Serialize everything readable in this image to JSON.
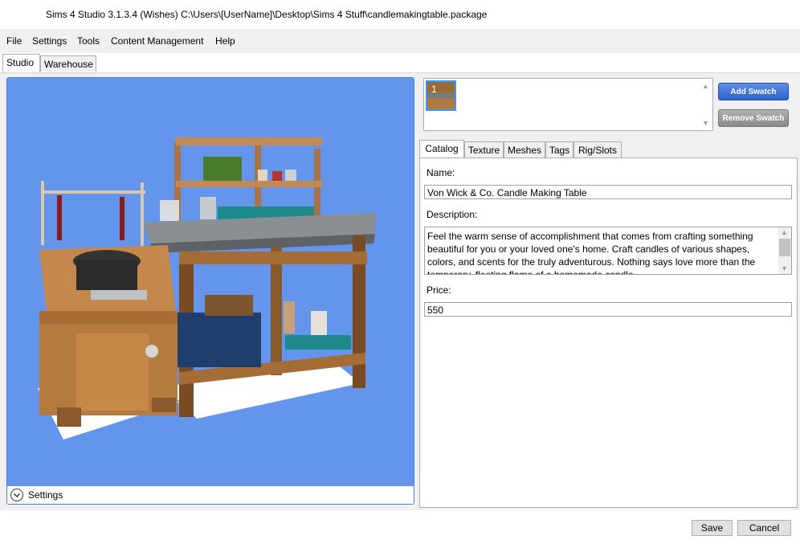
{
  "window": {
    "title": "Sims 4 Studio 3.1.3.4 (Wishes)  C:\\Users\\[UserName]\\Desktop\\Sims 4 Stuff\\candlemakingtable.package"
  },
  "menu": {
    "items": [
      "File",
      "Settings",
      "Tools",
      "Content Management",
      "Help"
    ]
  },
  "top_tabs": [
    {
      "label": "Studio",
      "active": true
    },
    {
      "label": "Warehouse",
      "active": false
    }
  ],
  "preview": {
    "settings_label": "Settings",
    "background_color": "#6495ed"
  },
  "swatches": {
    "items": [
      {
        "number": "1"
      }
    ],
    "add_label": "Add Swatch",
    "remove_label": "Remove Swatch"
  },
  "tabs": [
    {
      "label": "Catalog",
      "active": true
    },
    {
      "label": "Texture",
      "active": false
    },
    {
      "label": "Meshes",
      "active": false
    },
    {
      "label": "Tags",
      "active": false
    },
    {
      "label": "Rig/Slots",
      "active": false
    }
  ],
  "catalog": {
    "name_label": "Name:",
    "name_value": "Von Wick & Co. Candle Making Table",
    "description_label": "Description:",
    "description_value": "Feel the warm sense of accomplishment that comes from crafting something beautiful for you or your loved one's home. Craft candles of various shapes, colors, and scents for the truly adventurous. Nothing says love more than the temporary, fleeting flame of a homemade candle.",
    "price_label": "Price:",
    "price_value": "550"
  },
  "footer": {
    "save_label": "Save",
    "cancel_label": "Cancel"
  }
}
